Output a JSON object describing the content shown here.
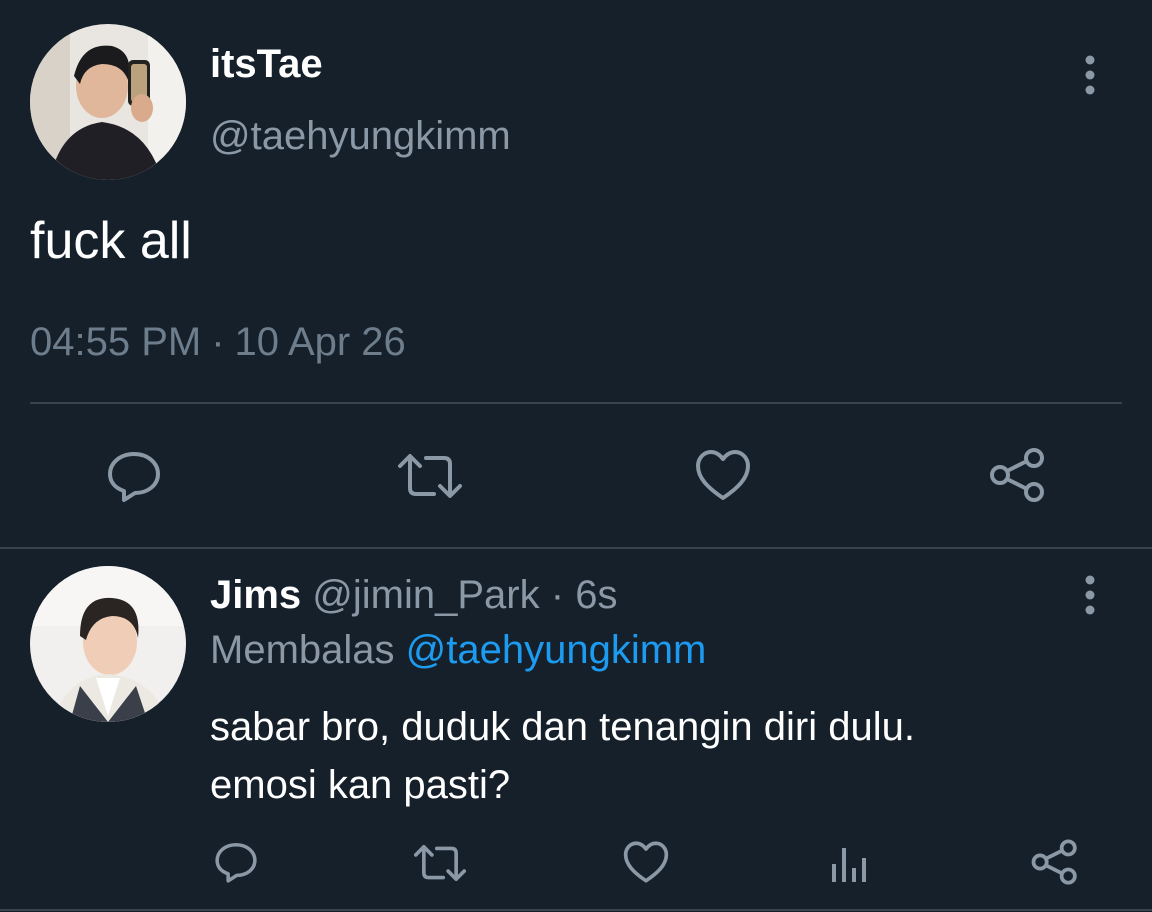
{
  "main_tweet": {
    "display_name": "itsTae",
    "handle": "@taehyungkimm",
    "text": "fuck all",
    "time": "04:55 PM",
    "separator": "·",
    "date": "10 Apr 26",
    "actions": [
      "reply-icon",
      "retweet-icon",
      "like-icon",
      "share-icon"
    ]
  },
  "reply_tweet": {
    "display_name": "Jims",
    "handle": "@jimin_Park",
    "separator": "·",
    "time_ago": "6s",
    "replying_label": "Membalas",
    "replying_to": "@taehyungkimm",
    "text_line1": "sabar bro, duduk dan tenangin diri dulu.",
    "text_line2": "emosi kan pasti?",
    "actions": [
      "reply-icon",
      "retweet-icon",
      "like-icon",
      "analytics-icon",
      "share-icon"
    ]
  },
  "colors": {
    "background": "#15202b",
    "primary_text": "#ffffff",
    "secondary_text": "#8b98a5",
    "link": "#1d9bf0",
    "divider": "#38444d"
  }
}
